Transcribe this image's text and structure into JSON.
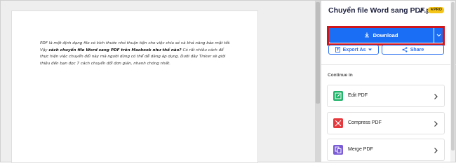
{
  "document": {
    "text_1": "PDF là một định dạng file có kích thước nhỏ thuận tiện cho việc chia sẻ và khả năng bảo mật tốt. Vậy ",
    "text_bold": "cách chuyển file Word sang PDF trên Macbook như thế nào?",
    "text_2": " Có rất nhiều cách để thực hiện việc chuyển đổi này mà người dùng có thể dễ dàng áp dụng. Dưới đây Tinker sẽ giới thiệu đến bạn đọc 7 cách chuyển đổi đơn giản, nhanh chóng nhất."
  },
  "panel": {
    "file_name": "Chuyển file Word sang PDF.pdf",
    "pro_badge": "★PRO",
    "download_label": "Download",
    "export_label": "Export As",
    "share_label": "Share",
    "continue_label": "Continue in",
    "actions": [
      {
        "label": "Edit PDF",
        "icon": "edit-pdf-icon",
        "color": "#22b46a"
      },
      {
        "label": "Compress PDF",
        "icon": "compress-pdf-icon",
        "color": "#e5393e"
      },
      {
        "label": "Merge PDF",
        "icon": "merge-pdf-icon",
        "color": "#7a5cd6"
      }
    ]
  },
  "colors": {
    "primary": "#1a6ef5",
    "highlight": "#d0161d",
    "pro_badge": "#f5c518"
  }
}
